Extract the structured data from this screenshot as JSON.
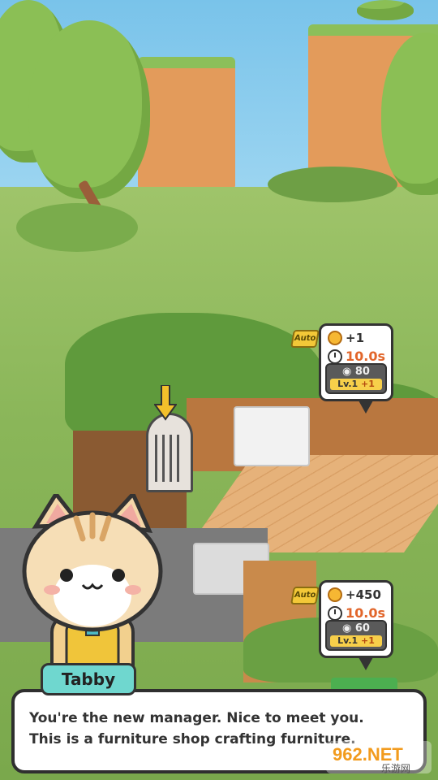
{
  "stations": [
    {
      "auto_label": "Auto",
      "gain": "+1",
      "time": "10.0s",
      "upgrade_cost": "80",
      "level": "Lv.1",
      "level_plus": "+1"
    },
    {
      "auto_label": "Auto",
      "gain": "+450",
      "time": "10.0s",
      "upgrade_cost": "60",
      "level": "Lv.1",
      "level_plus": "+1"
    }
  ],
  "dialog": {
    "speaker": "Tabby",
    "line1": "You're the new manager. Nice to meet you.",
    "line2": "This is a furniture shop crafting furniture."
  },
  "watermark": {
    "text": "962.NET",
    "subtext": "乐游网"
  },
  "colors": {
    "accent_time": "#e2662b",
    "nametag": "#6fd7cf",
    "level_bar": "#f7cf4a"
  }
}
